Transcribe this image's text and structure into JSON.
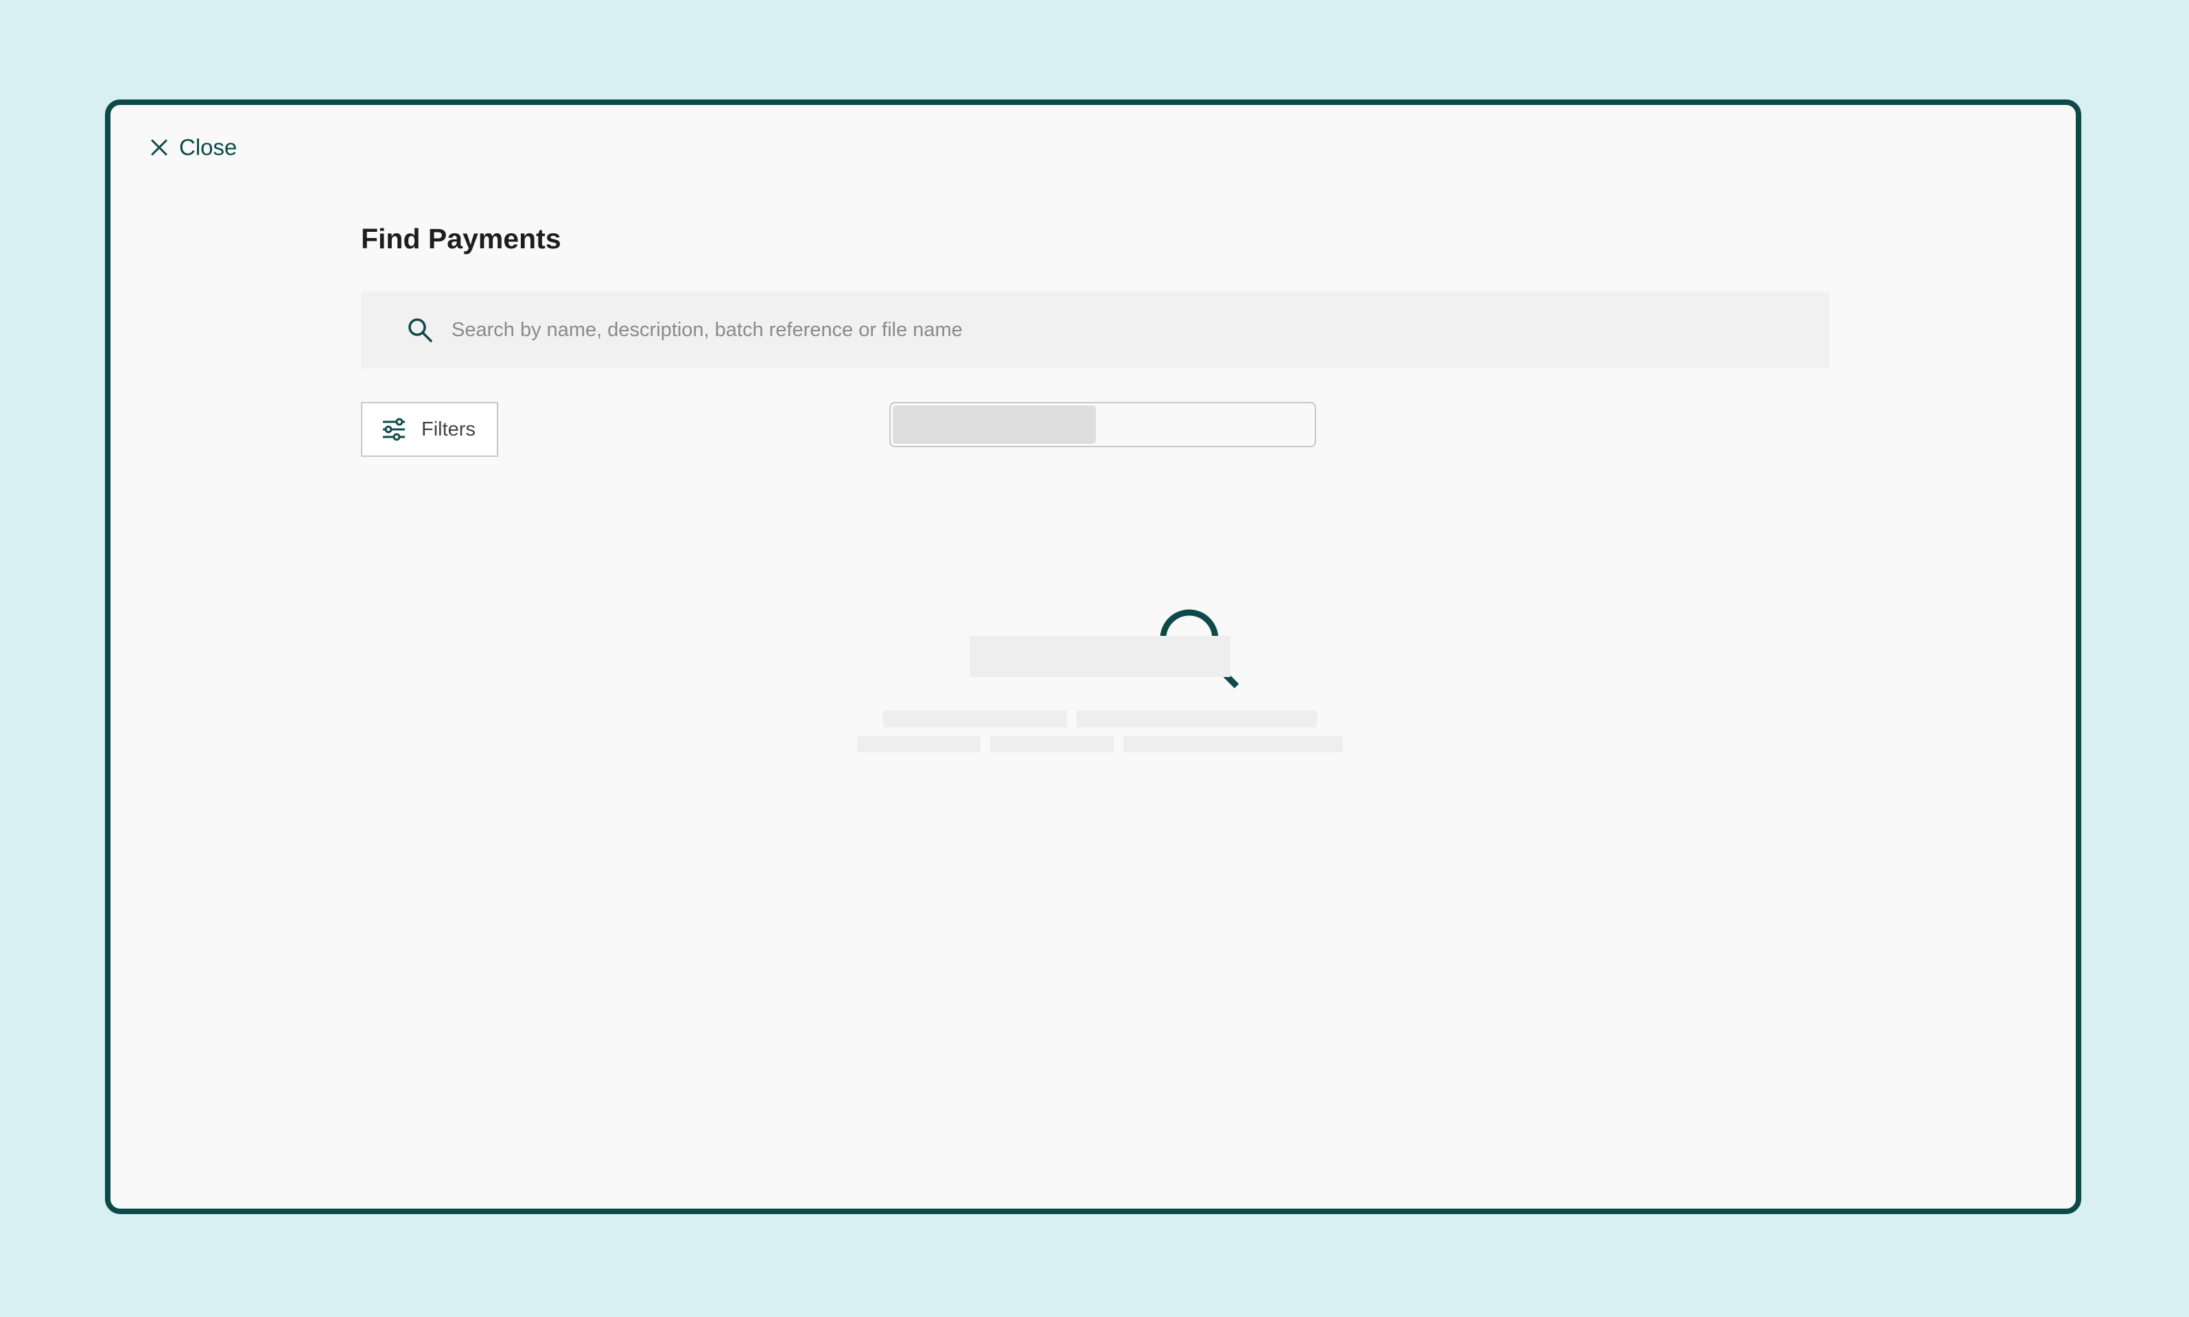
{
  "close_label": "Close",
  "page_title": "Find Payments",
  "search": {
    "placeholder": "Search by name, description, batch reference or file name",
    "value": ""
  },
  "filters_label": "Filters",
  "segmented_control": {
    "selected_index": 0,
    "segment_count": 2
  },
  "colors": {
    "accent": "#0c4a4a",
    "background": "#d8f0f1",
    "surface": "#f9f9f9",
    "skeleton": "#eeeeee"
  },
  "icons": [
    "close-icon",
    "search-icon",
    "sliders-icon",
    "magnifier-icon"
  ]
}
